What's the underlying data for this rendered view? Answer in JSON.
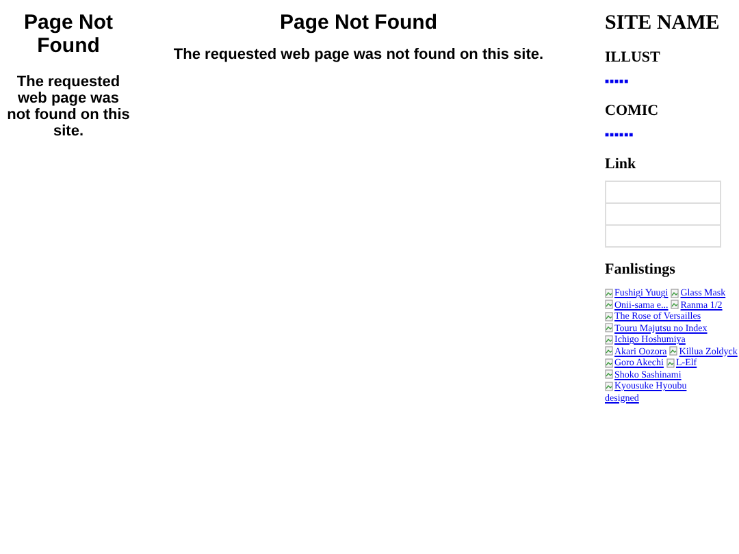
{
  "left": {
    "title": "Page Not Found",
    "message": "The requested web page was not found on this site."
  },
  "main": {
    "title": "Page Not Found",
    "message": "The requested web page was not found on this site."
  },
  "sidebar": {
    "site_name": "SITE NAME",
    "sections": [
      {
        "kind": "dots",
        "heading": "ILLUST",
        "dots": "■■■■■"
      },
      {
        "kind": "dots",
        "heading": "COMIC",
        "dots": "■■■■■■"
      },
      {
        "kind": "boxes",
        "heading": "Link"
      }
    ],
    "fanlistings": {
      "heading": "Fanlistings",
      "rows": [
        [
          "Fushigi Yuugi",
          "Glass Mask"
        ],
        [
          "Onii-sama e...",
          "Ranma 1/2"
        ],
        [
          "The Rose of Versailles"
        ],
        [
          "Touru Majutsu no Index"
        ],
        [
          "Ichigo Hoshumiya"
        ],
        [
          "Akari Oozora",
          "Killua Zoldyck"
        ],
        [
          "Goro Akechi",
          "L-Elf"
        ],
        [
          "Shoko Sashinami"
        ],
        [
          "Kyousuke Hyoubu"
        ]
      ],
      "footer_link": "designed"
    }
  }
}
